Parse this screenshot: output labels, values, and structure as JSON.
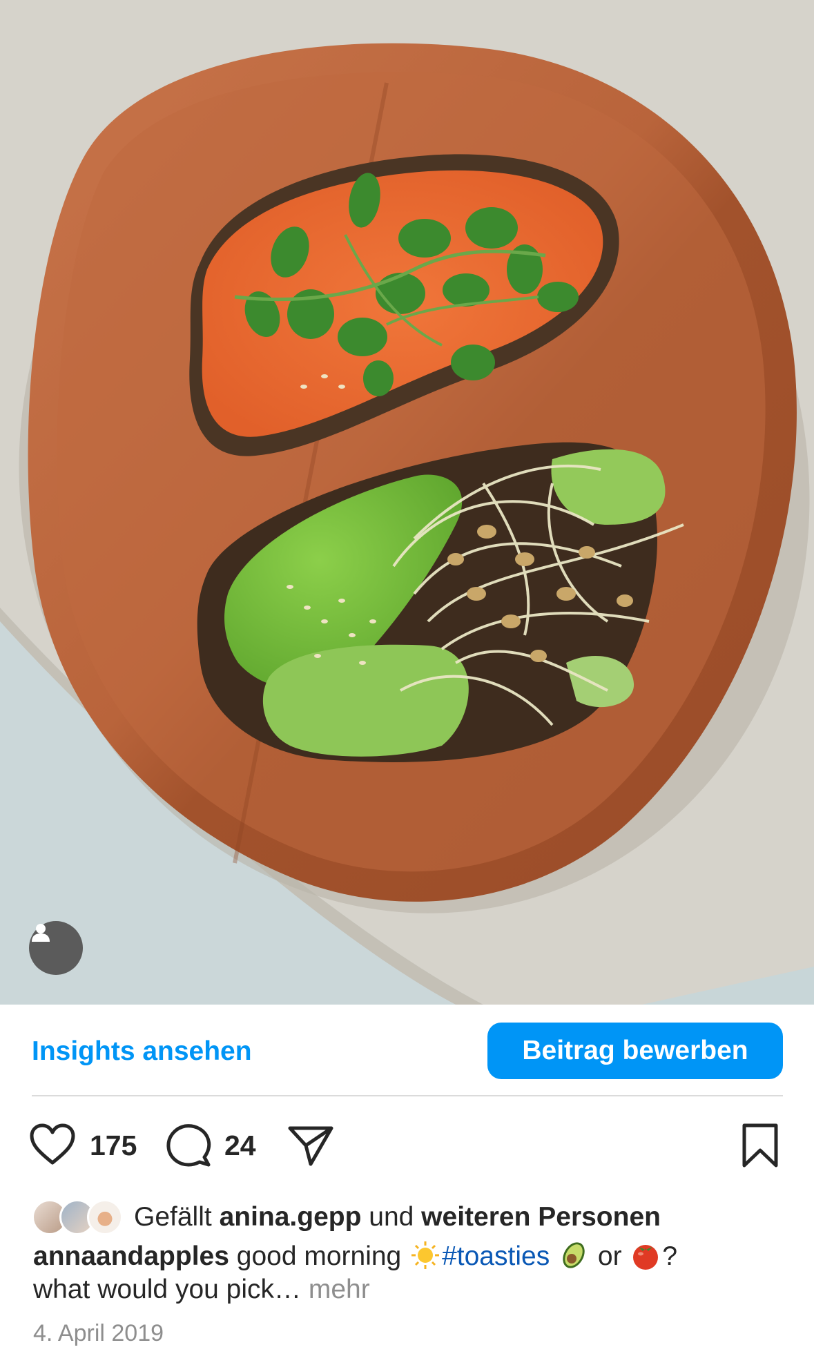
{
  "post": {
    "image_alt": "Two toasts on a wooden plate: one with orange spread and herbs, one with avocado and sprouts",
    "tag_icon": "person-icon"
  },
  "insights": {
    "link_label": "Insights ansehen",
    "promote_label": "Beitrag bewerben"
  },
  "actions": {
    "like_icon": "heart-icon",
    "like_count": "175",
    "comment_icon": "comment-icon",
    "comment_count": "24",
    "share_icon": "send-icon",
    "save_icon": "bookmark-icon"
  },
  "likes": {
    "prefix": "Gefällt ",
    "user": "anina.gepp",
    "middle": " und ",
    "rest": "weiteren Personen"
  },
  "caption": {
    "username": "annaandapples",
    "text_1": " good morning ",
    "hashtag": "#toasties",
    "text_2": " or ",
    "text_3": "?",
    "line_2": "what would you pick…",
    "more": " mehr"
  },
  "date": "4. April 2019",
  "colors": {
    "accent_blue": "#0095f6",
    "text": "#262626",
    "muted": "#8e8e8e"
  }
}
